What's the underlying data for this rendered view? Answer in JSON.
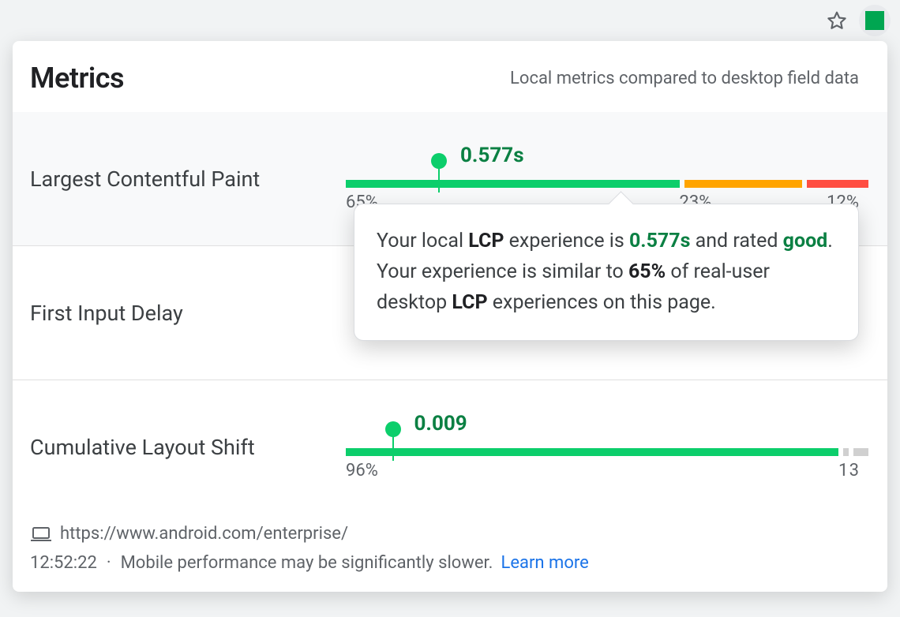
{
  "header": {
    "title": "Metrics",
    "subtitle": "Local metrics compared to desktop field data"
  },
  "metrics": [
    {
      "name": "Largest Contentful Paint",
      "value_label": "0.577s",
      "marker_pct": 18,
      "segments": [
        {
          "cls": "good",
          "pct": 65,
          "label": "65%"
        },
        {
          "cls": "warn",
          "pct": 23,
          "label": "23%"
        },
        {
          "cls": "bad",
          "pct": 12,
          "label": "12%"
        }
      ]
    },
    {
      "name": "First Input Delay",
      "value_label": "",
      "marker_pct": null,
      "segments": []
    },
    {
      "name": "Cumulative Layout Shift",
      "value_label": "0.009",
      "marker_pct": 9,
      "segments": [
        {
          "cls": "good",
          "pct": 96,
          "label": "96%"
        },
        {
          "cls": "gray",
          "pct": 1,
          "label": "1"
        },
        {
          "cls": "gray",
          "pct": 3,
          "label": "3"
        }
      ]
    }
  ],
  "tooltip": {
    "pre": "Your local ",
    "abbr1": "LCP",
    "mid1": " experience is ",
    "value": "0.577s",
    "mid2": " and rated ",
    "rating": "good",
    "post1": ". Your experience is similar to ",
    "percent": "65%",
    "post2": " of real-user desktop ",
    "abbr2": "LCP",
    "post3": " experiences on this page."
  },
  "footer": {
    "url": "https://www.android.com/enterprise/",
    "time": "12:52:22",
    "note": "Mobile performance may be significantly slower.",
    "learn": "Learn more"
  },
  "colors": {
    "good": "#0cce6b",
    "warn": "#ffa400",
    "bad": "#ff4e42",
    "good_text": "#0b8043",
    "link": "#1a73e8"
  }
}
